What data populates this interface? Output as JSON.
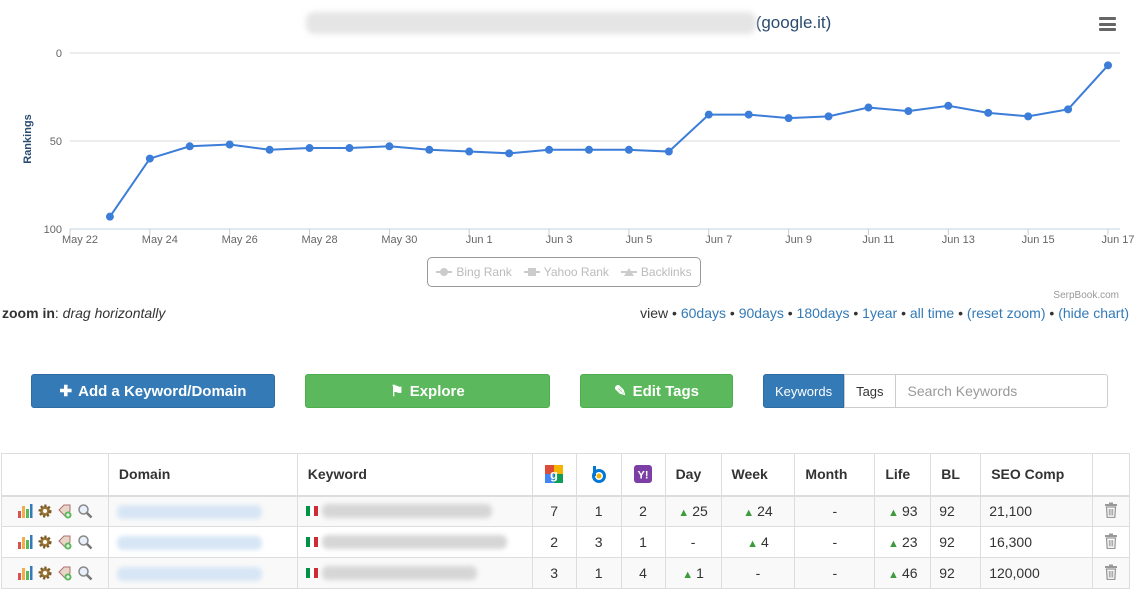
{
  "chart": {
    "title_suffix": "(google.it)",
    "ylabel": "Rankings",
    "credit": "SerpBook.com",
    "legend": [
      "Bing Rank",
      "Yahoo Rank",
      "Backlinks"
    ]
  },
  "chart_data": {
    "type": "line",
    "title": "(google.it)",
    "xlabel": "",
    "ylabel": "Rankings",
    "ylim": [
      100,
      0
    ],
    "y_reversed": true,
    "yticks": [
      "0",
      "50",
      "100"
    ],
    "xticks": [
      "May 22",
      "May 24",
      "May 26",
      "May 28",
      "May 30",
      "Jun 1",
      "Jun 3",
      "Jun 5",
      "Jun 7",
      "Jun 9",
      "Jun 11",
      "Jun 13",
      "Jun 15",
      "Jun 17"
    ],
    "grid": true,
    "legend_position": "bottom",
    "series": [
      {
        "name": "",
        "color": "#3b7dd8",
        "x": [
          "May 23",
          "May 24",
          "May 25",
          "May 26",
          "May 27",
          "May 28",
          "May 29",
          "May 30",
          "May 31",
          "Jun 1",
          "Jun 2",
          "Jun 3",
          "Jun 4",
          "Jun 5",
          "Jun 6",
          "Jun 7",
          "Jun 8",
          "Jun 9",
          "Jun 10",
          "Jun 11",
          "Jun 12",
          "Jun 13",
          "Jun 14",
          "Jun 15",
          "Jun 16",
          "Jun 17"
        ],
        "y": [
          93,
          60,
          53,
          52,
          55,
          54,
          54,
          53,
          55,
          56,
          57,
          55,
          55,
          55,
          56,
          35,
          35,
          37,
          36,
          31,
          33,
          30,
          34,
          36,
          32,
          7
        ]
      }
    ]
  },
  "controls": {
    "zoom_label": "zoom in",
    "zoom_hint": "drag horizontally",
    "view_label": "view",
    "view_links": [
      "60days",
      "90days",
      "180days",
      "1year",
      "all time",
      "(reset zoom)",
      "(hide chart)"
    ]
  },
  "actions": {
    "add_label": "Add a Keyword/Domain",
    "explore_label": "Explore",
    "edit_tags_label": "Edit Tags",
    "tab_keywords": "Keywords",
    "tab_tags": "Tags",
    "search_placeholder": "Search Keywords"
  },
  "table": {
    "headers": {
      "domain": "Domain",
      "keyword": "Keyword",
      "day": "Day",
      "week": "Week",
      "month": "Month",
      "life": "Life",
      "bl": "BL",
      "seo": "SEO Comp"
    },
    "rows": [
      {
        "google": "7",
        "bing": "1",
        "yahoo": "2",
        "day": "25",
        "day_up": true,
        "week": "24",
        "week_up": true,
        "month": "-",
        "life": "93",
        "bl": "92",
        "seo": "21,100"
      },
      {
        "google": "2",
        "bing": "3",
        "yahoo": "1",
        "day": "-",
        "day_up": false,
        "week": "4",
        "week_up": true,
        "month": "-",
        "life": "23",
        "bl": "92",
        "seo": "16,300"
      },
      {
        "google": "3",
        "bing": "1",
        "yahoo": "4",
        "day": "1",
        "day_up": true,
        "week": "-",
        "week_up": false,
        "month": "-",
        "life": "46",
        "bl": "92",
        "seo": "120,000"
      }
    ]
  },
  "colors": {
    "primary": "#337ab7",
    "success": "#5cb85c",
    "line": "#3b7dd8",
    "arrow_up": "#3c9b3c"
  }
}
